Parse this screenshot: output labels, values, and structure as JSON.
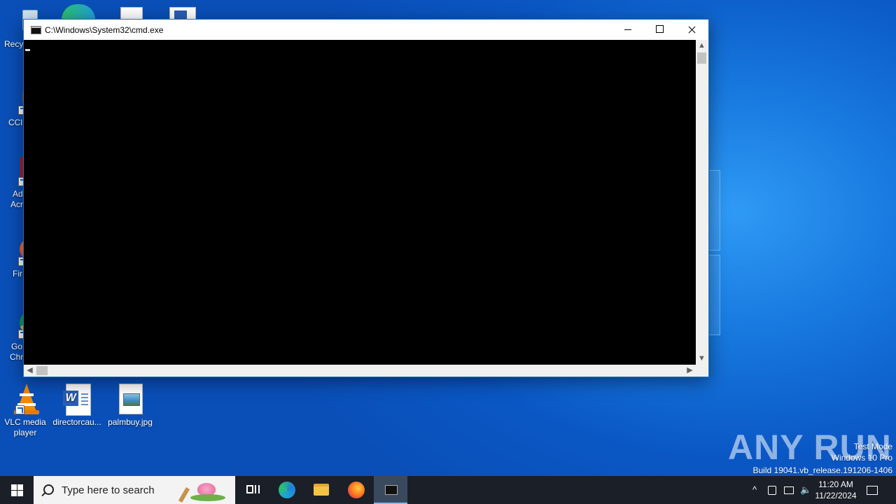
{
  "cmd_window": {
    "title": "C:\\Windows\\System32\\cmd.exe"
  },
  "desktop": {
    "icons_partial": [
      {
        "label": "Recy",
        "icon": "recycle-bin-icon"
      },
      {
        "label": "CCl",
        "icon": "ccleaner-icon"
      },
      {
        "label": "Ad",
        "label2": "Acr",
        "icon": "acrobat-icon"
      },
      {
        "label": "Fir",
        "icon": "firefox-icon"
      },
      {
        "label": "Go",
        "label2": "Chr",
        "icon": "chrome-icon"
      }
    ],
    "icons": [
      {
        "label": "VLC media player",
        "icon": "vlc-icon"
      },
      {
        "label": "directorcau...",
        "icon": "word-doc-icon"
      },
      {
        "label": "palmbuy.jpg",
        "icon": "image-file-icon"
      }
    ]
  },
  "watermark": {
    "brand": "ANY RUN",
    "test_mode": "Test Mode",
    "edition": "Windows 10 Pro",
    "build": "Build 19041.vb_release.191206-1406"
  },
  "taskbar": {
    "search_placeholder": "Type here to search",
    "apps": [
      "task-view-icon",
      "edge-icon",
      "file-explorer-icon",
      "firefox-icon",
      "cmd-icon"
    ],
    "time": "11:20 AM",
    "date": "11/22/2024"
  },
  "colors": {
    "desktop": "#0a57c4",
    "taskbar": "#1b1f27",
    "console": "#000000"
  }
}
